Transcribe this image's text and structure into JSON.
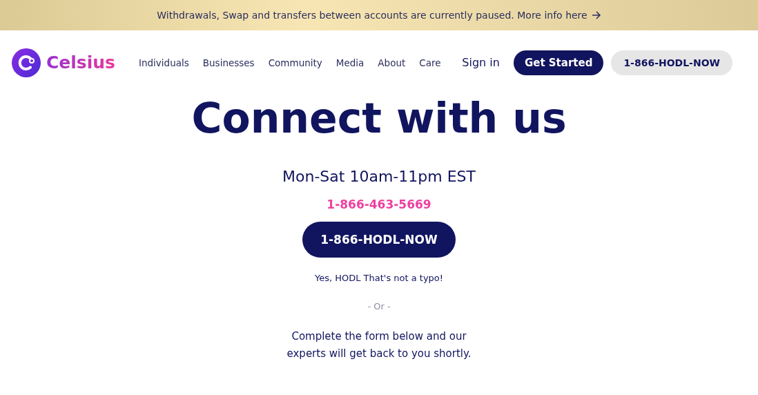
{
  "banner": {
    "text": "Withdrawals, Swap and transfers between accounts are currently paused. More info here"
  },
  "header": {
    "brand": "Celsius",
    "nav": [
      "Individuals",
      "Businesses",
      "Community",
      "Media",
      "About",
      "Care"
    ],
    "sign_in": "Sign in",
    "get_started": "Get Started",
    "phone_button": "1-866-HODL-NOW"
  },
  "main": {
    "title": "Connect with us",
    "hours": "Mon-Sat 10am-11pm EST",
    "phone": "1-866-463-5669",
    "hodl_button": "1-866-HODL-NOW",
    "note": "Yes, HODL That's not a typo!",
    "divider": "- Or -",
    "form_intro": "Complete the form below and our experts will get back to you shortly."
  }
}
